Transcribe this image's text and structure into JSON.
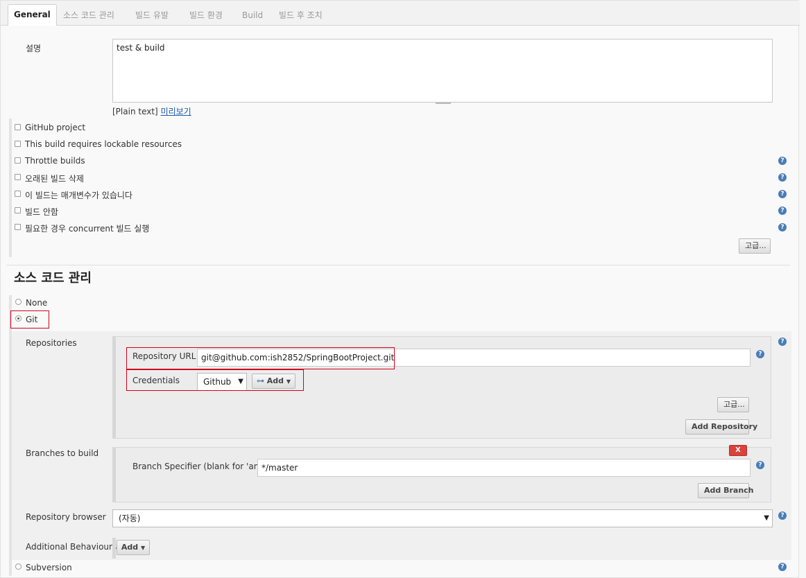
{
  "tabs": [
    {
      "label": "General",
      "active": true
    },
    {
      "label": "소스 코드 관리",
      "active": false
    },
    {
      "label": "빌드 유발",
      "active": false
    },
    {
      "label": "빌드 환경",
      "active": false
    },
    {
      "label": "Build",
      "active": false
    },
    {
      "label": "빌드 후 조치",
      "active": false
    }
  ],
  "general": {
    "description_label": "설명",
    "description_value": "test & build",
    "plain_text": "[Plain text]",
    "preview_link": "미리보기",
    "options": [
      {
        "label": "GitHub project",
        "checked": false,
        "help": false
      },
      {
        "label": "This build requires lockable resources",
        "checked": false,
        "help": false
      },
      {
        "label": "Throttle builds",
        "checked": false,
        "help": true
      },
      {
        "label": "오래된 빌드 삭제",
        "checked": false,
        "help": true
      },
      {
        "label": "이 빌드는 매개변수가 있습니다",
        "checked": false,
        "help": true
      },
      {
        "label": "빌드 안함",
        "checked": false,
        "help": true
      },
      {
        "label": "필요한 경우 concurrent 빌드 실행",
        "checked": false,
        "help": true
      }
    ],
    "advanced_button": "고급..."
  },
  "scm": {
    "title": "소스 코드 관리",
    "options": [
      {
        "label": "None",
        "selected": false
      },
      {
        "label": "Git",
        "selected": true
      },
      {
        "label": "Subversion",
        "selected": false
      }
    ],
    "repositories_label": "Repositories",
    "repository_url_label": "Repository URL",
    "repository_url_value": "git@github.com:ish2852/SpringBootProject.git",
    "credentials_label": "Credentials",
    "credentials_value": "Github",
    "add_label": "Add",
    "advanced_button": "고급...",
    "add_repository_button": "Add Repository",
    "branches_label": "Branches to build",
    "delete_button": "X",
    "branch_specifier_label": "Branch Specifier (blank for 'any')",
    "branch_specifier_value": "*/master",
    "add_branch_button": "Add Branch",
    "repo_browser_label": "Repository browser",
    "repo_browser_value": "(자동)",
    "additional_behaviours_label": "Additional Behaviours",
    "additional_add_label": "Add"
  },
  "icons": {
    "help": "help-icon",
    "key": "key-icon",
    "dropdown": "chevron-down-icon"
  },
  "colors": {
    "help_icon": "#4a7db8",
    "highlight_border": "#d0021b",
    "delete_button": "#d9433b",
    "link": "#1a58b0"
  }
}
